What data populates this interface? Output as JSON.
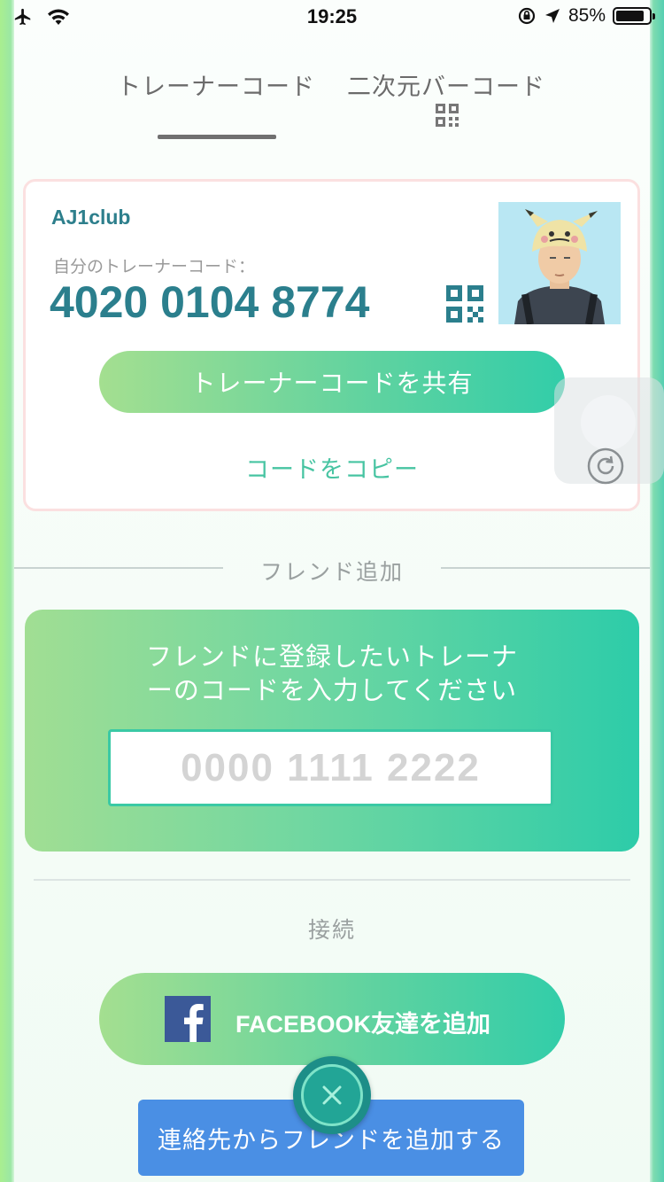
{
  "status_bar": {
    "time": "19:25",
    "battery_percent": "85%",
    "battery_level": 0.85
  },
  "tabs": [
    {
      "label": "トレーナーコード",
      "active": true
    },
    {
      "label": "二次元バーコード",
      "active": false,
      "icon": "qr-code-icon"
    }
  ],
  "trainer_card": {
    "username": "AJ1club",
    "code_label": "自分のトレーナーコード：",
    "code": "4020 0104 8774",
    "share_button": "トレーナーコードを共有",
    "copy_link": "コードをコピー"
  },
  "add_friend": {
    "section_title": "フレンド追加",
    "instruction_line1": "フレンドに登録したいトレーナ",
    "instruction_line2": "ーのコードを入力してください",
    "input_placeholder": "0000 1111 2222"
  },
  "connect": {
    "section_title": "接続",
    "facebook_button": "FACEBOOK友達を追加",
    "contacts_button": "連絡先からフレンドを追加する"
  },
  "colors": {
    "accent_teal": "#2b7f8d",
    "gradient_start": "#a4df90",
    "gradient_end": "#32cda9",
    "contacts_blue": "#4a8fe4",
    "facebook_blue": "#3b5998"
  }
}
